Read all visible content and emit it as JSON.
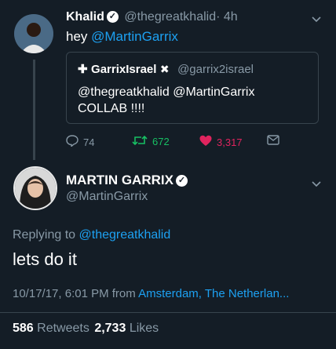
{
  "tweet1": {
    "author_name": "Khalid",
    "author_handle": "@thegreatkhalid",
    "time": "· 4h",
    "text_prefix": "hey ",
    "mention": "@MartinGarrix"
  },
  "quote": {
    "author_prefix": "✚",
    "author_name": "GarrixIsrael",
    "author_suffix": "✖",
    "author_handle": "@garrix2israel",
    "line1": "@thegreatkhalid @MartinGarrix",
    "line2": "COLLAB !!!!"
  },
  "actions": {
    "replies": "74",
    "retweets": "672",
    "likes": "3,317"
  },
  "tweet2": {
    "author_name": "MARTIN GARRIX",
    "author_handle": "@MartinGarrix",
    "replying_label": "Replying to",
    "replying_to": "@thegreatkhalid",
    "text": "lets do it",
    "timestamp": "10/17/17, 6:01 PM from",
    "location": "Amsterdam, The Netherlan..."
  },
  "stats": {
    "retweets_count": "586",
    "retweets_label": "Retweets",
    "likes_count": "2,733",
    "likes_label": "Likes"
  },
  "colors": {
    "background": "#141d26",
    "link": "#1da1f2",
    "muted": "#8899a6",
    "retweet_green": "#17bf63",
    "like_red": "#e0245e"
  }
}
